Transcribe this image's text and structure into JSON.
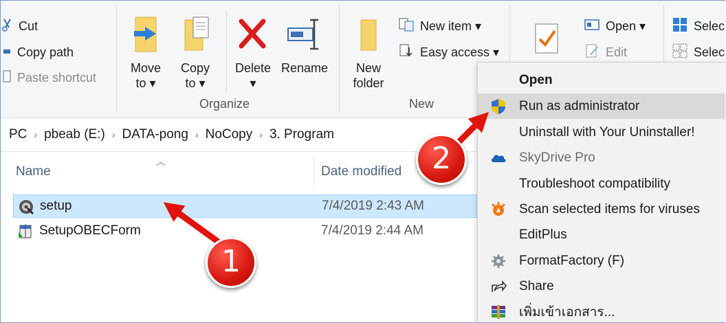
{
  "ribbon": {
    "clipboard": {
      "cut": "Cut",
      "copy_path": "Copy path",
      "paste_shortcut": "Paste shortcut"
    },
    "organize": {
      "move_to_line1": "Move",
      "move_to_line2": "to ▾",
      "copy_to_line1": "Copy",
      "copy_to_line2": "to ▾",
      "delete_line1": "Delete",
      "delete_line2": "▾",
      "rename": "Rename",
      "group_label": "Organize"
    },
    "new": {
      "new_folder_line1": "New",
      "new_folder_line2": "folder",
      "new_item": "New item ▾",
      "easy_access": "Easy access ▾",
      "group_label": "New"
    },
    "open": {
      "open": "Open ▾",
      "edit": "Edit"
    },
    "select": {
      "select_all": "Selec",
      "select_none": "Selec"
    }
  },
  "address": {
    "crumbs": [
      "PC",
      "pbeab (E:)",
      "DATA-pong",
      "NoCopy",
      "3. Program"
    ],
    "sep": "›"
  },
  "columns": {
    "name": "Name",
    "date_modified": "Date modified"
  },
  "files": [
    {
      "name": "setup",
      "date": "7/4/2019 2:43 AM",
      "selected": true
    },
    {
      "name": "SetupOBECForm",
      "date": "7/4/2019 2:44 AM",
      "selected": false
    }
  ],
  "context_menu": {
    "items": [
      {
        "label": "Open",
        "icon": "none"
      },
      {
        "label": "Run as administrator",
        "icon": "uac-shield-icon"
      },
      {
        "label": "Uninstall with Your Uninstaller!",
        "icon": "none"
      },
      {
        "label": "SkyDrive Pro",
        "icon": "skydrive-cloud-icon"
      },
      {
        "label": "Troubleshoot compatibility",
        "icon": "none"
      },
      {
        "label": "Scan selected items for viruses",
        "icon": "avast-icon"
      },
      {
        "label": "EditPlus",
        "icon": "none"
      },
      {
        "label": "FormatFactory (F)",
        "icon": "formatfactory-icon"
      },
      {
        "label": "Share",
        "icon": "share-icon"
      },
      {
        "label": "เพิ่มเข้าเอกสาร...",
        "icon": "winrar-icon"
      }
    ]
  },
  "annotations": {
    "badge1": "1",
    "badge2": "2"
  },
  "colors": {
    "selection": "#cce8ff",
    "menu_highlight": "#d9d9d9",
    "annotation_red": "#e0140c",
    "delete_red": "#d81e1e",
    "folder_yellow": "#f2c94c",
    "move_blue": "#2f7fd6"
  }
}
